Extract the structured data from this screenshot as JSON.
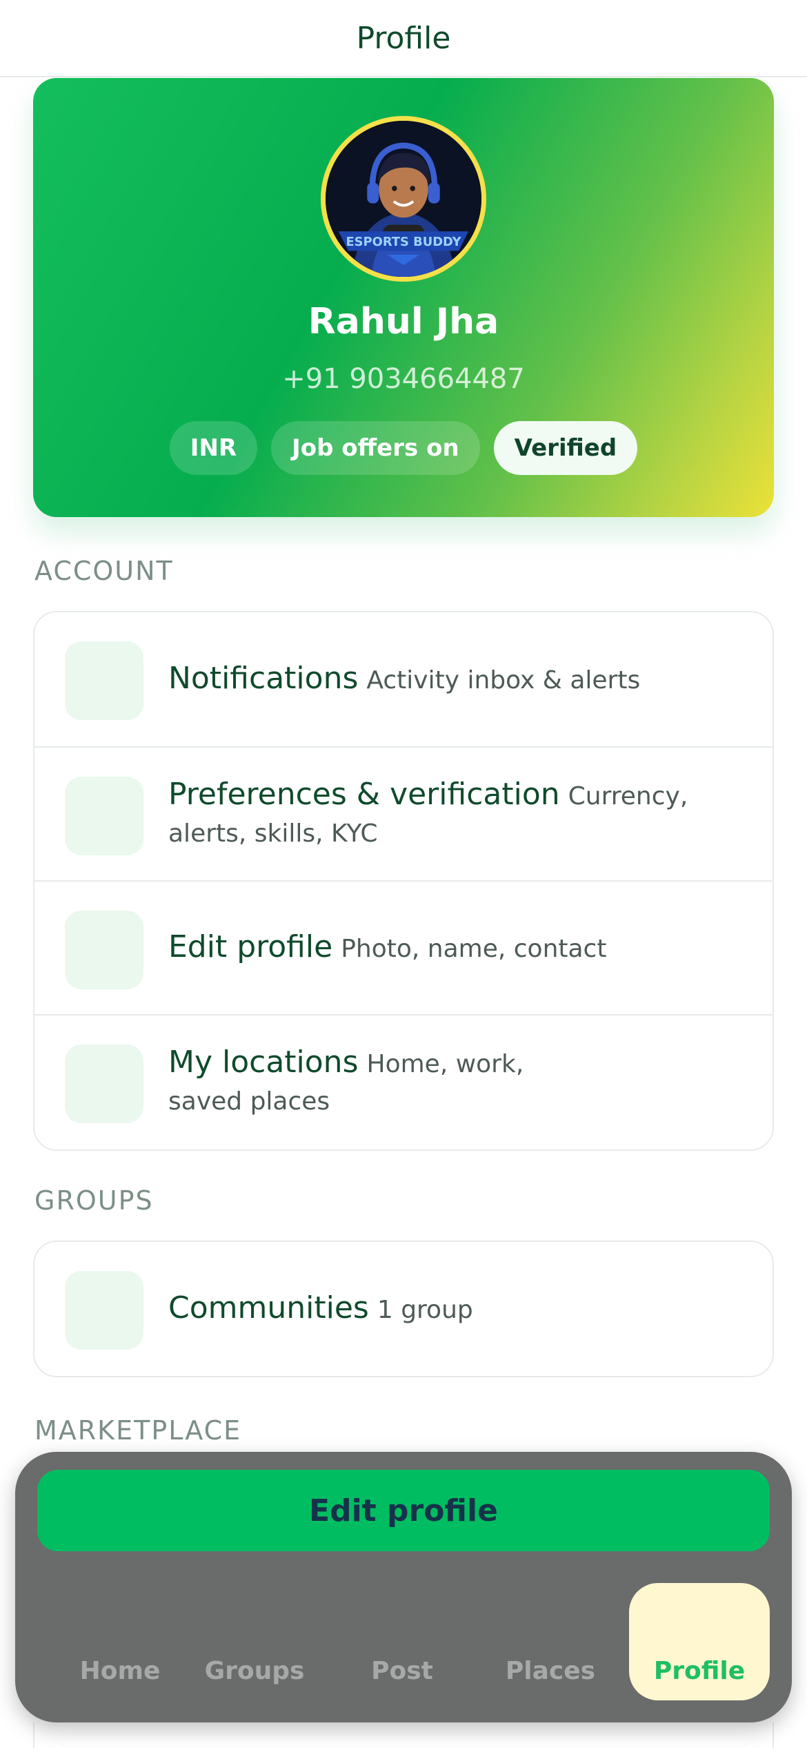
{
  "header": {
    "title": "Profile"
  },
  "profile": {
    "name": "Rahul Jha",
    "phone": "+91 9034664487",
    "avatar_badge": "ESPORTS BUDDY",
    "chips": [
      "INR",
      "Job offers on",
      "Verified"
    ],
    "colors": {
      "gradient_start": "#15be5c",
      "gradient_end": "#ece138",
      "avatar_ring": "#f5e04a"
    }
  },
  "account": {
    "label": "ACCOUNT",
    "items": [
      {
        "title": "Notifications",
        "subtitle": "Activity inbox & alerts"
      },
      {
        "title": "Preferences & verification",
        "subtitle": "Currency, alerts, skills, KYC"
      },
      {
        "title": "Edit profile",
        "subtitle": "Photo, name, contact"
      },
      {
        "title": "My locations",
        "subtitle": "Home, work, saved places"
      }
    ]
  },
  "groups": {
    "label": "GROUPS",
    "items": [
      {
        "title": "Communities",
        "subtitle": "1 group"
      }
    ]
  },
  "marketplace": {
    "label": "MARKETPLACE"
  },
  "dock": {
    "cta_label": "Edit profile",
    "tabs": [
      "Home",
      "Groups",
      "Post",
      "Places",
      "Profile"
    ],
    "active_tab": "Profile",
    "colors": {
      "cta": "#00bd61",
      "active_tab_bg": "#fff7cf",
      "active_tab_text": "#1fbe64"
    }
  }
}
